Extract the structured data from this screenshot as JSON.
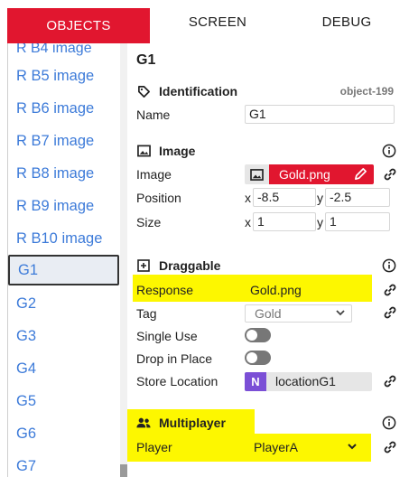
{
  "tabs": [
    {
      "label": "OBJECTS",
      "active": true
    },
    {
      "label": "SCREEN",
      "active": false
    },
    {
      "label": "DEBUG",
      "active": false
    }
  ],
  "object_list": {
    "partial_top": "R B4 image",
    "items": [
      "R B5 image",
      "R B6 image",
      "R B7 image",
      "R B8 image",
      "R B9 image",
      "R B10 image",
      "G1",
      "G2",
      "G3",
      "G4",
      "G5",
      "G6",
      "G7"
    ],
    "selected": "G1"
  },
  "object": {
    "title": "G1",
    "identification": {
      "heading": "Identification",
      "id": "object-199",
      "name_label": "Name",
      "name_value": "G1"
    },
    "image": {
      "heading": "Image",
      "image_label": "Image",
      "image_file": "Gold.png",
      "position_label": "Position",
      "pos_x_label": "x",
      "pos_x": "-8.5",
      "pos_y_label": "y",
      "pos_y": "-2.5",
      "size_label": "Size",
      "size_x_label": "x",
      "size_x": "1",
      "size_y_label": "y",
      "size_y": "1"
    },
    "draggable": {
      "heading": "Draggable",
      "response_label": "Response",
      "response_value": "Gold.png",
      "tag_label": "Tag",
      "tag_value": "Gold",
      "single_use_label": "Single Use",
      "single_use": false,
      "drop_in_place_label": "Drop in Place",
      "drop_in_place": false,
      "store_location_label": "Store Location",
      "store_location_badge": "N",
      "store_location_value": "locationG1"
    },
    "multiplayer": {
      "heading": "Multiplayer",
      "player_label": "Player",
      "player_value": "PlayerA"
    }
  },
  "colors": {
    "accent": "#e1162f",
    "highlight": "#fdf700",
    "link": "#3d7bd9",
    "location_badge": "#7b4fd6"
  }
}
